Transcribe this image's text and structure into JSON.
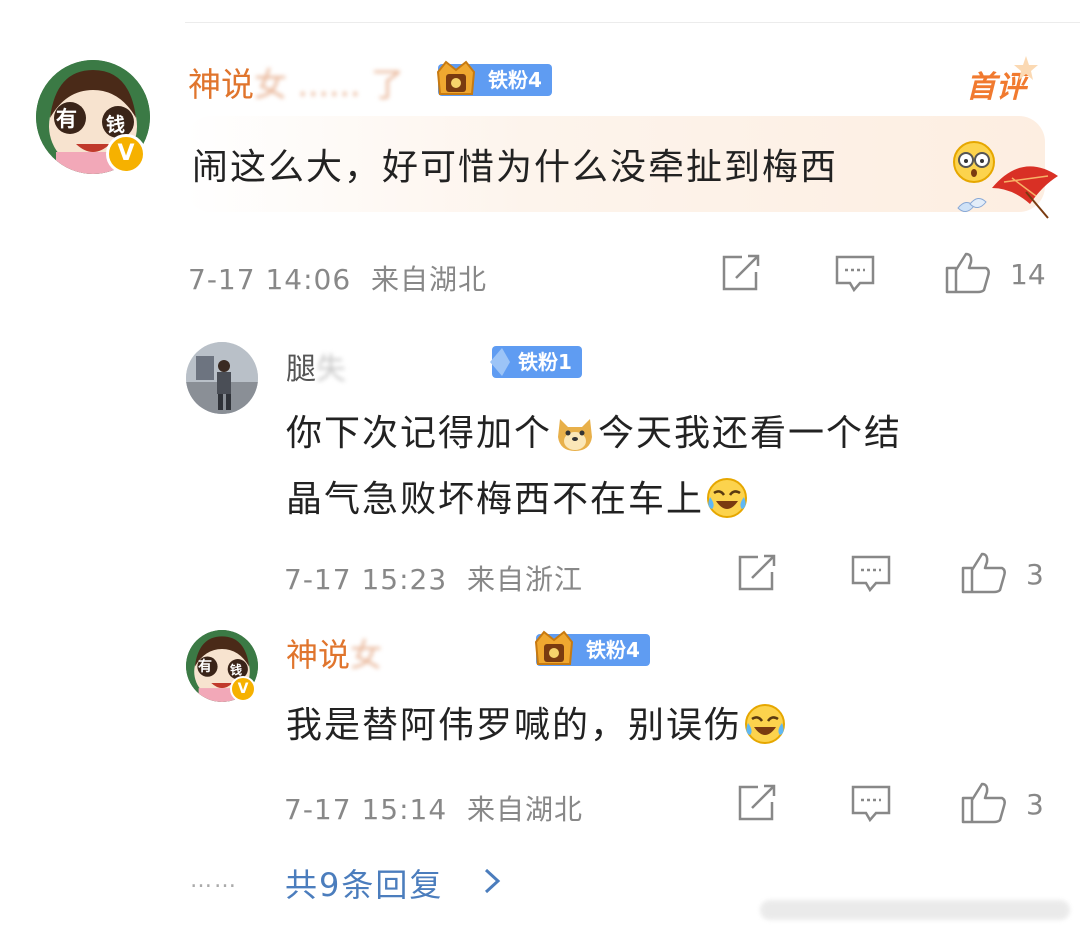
{
  "comments": [
    {
      "username": "神说",
      "username_blurred": "女 ...... 了",
      "fan_badge": "铁粉4",
      "first_comment_label": "首评",
      "avatar_text_left": "有",
      "avatar_text_right": "钱",
      "verified": "V",
      "text": "闹这么大，好可惜为什么没牵扯到梅西",
      "emoji_name": "shocked-emoji",
      "time": "7-17 14:06",
      "location": "来自湖北",
      "likes": "14"
    },
    {
      "username": "腿",
      "username_blurred": "失",
      "fan_badge": "铁粉1",
      "text_line1": "你下次记得加个",
      "text_line1b": "今天我还看一个结",
      "text_line2": "晶气急败坏梅西不在车上",
      "time": "7-17 15:23",
      "location": "来自浙江",
      "likes": "3"
    },
    {
      "username": "神说",
      "username_blurred": "女",
      "fan_badge": "铁粉4",
      "avatar_text_left": "有",
      "avatar_text_right": "钱",
      "verified": "V",
      "text": "我是替阿伟罗喊的，别误伤",
      "time": "7-17 15:14",
      "location": "来自湖北",
      "likes": "3"
    }
  ],
  "more_replies": "共9条回复",
  "dots": "……",
  "colors": {
    "username": "#e0752d",
    "fan_badge": "#5f9cf2",
    "link": "#4b7dbd",
    "first_comment": "#f17a2f"
  }
}
